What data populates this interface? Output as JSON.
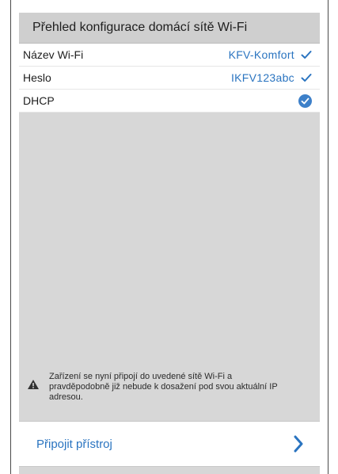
{
  "header": {
    "title": "Přehled konfigurace domácí sítě Wi-Fi"
  },
  "rows": [
    {
      "label": "Název Wi-Fi",
      "value": "KFV-Komfort",
      "icon": "check-icon"
    },
    {
      "label": "Heslo",
      "value": "IKFV123abc",
      "icon": "check-icon"
    },
    {
      "label": "DHCP",
      "value": "",
      "icon": "check-circle-icon"
    }
  ],
  "notice": {
    "icon": "warning-triangle-icon",
    "text": "Zařízení se nyní připojí do uvedené sítě Wi-Fi a pravděpodobně již nebude k dosažení pod svou aktuální IP adresou."
  },
  "connect": {
    "label": "Připojit přístroj",
    "icon": "chevron-right-icon"
  },
  "colors": {
    "accent": "#2a74c0",
    "header_bg": "#cfcfcf",
    "panel_bg": "#d7d7d7"
  }
}
